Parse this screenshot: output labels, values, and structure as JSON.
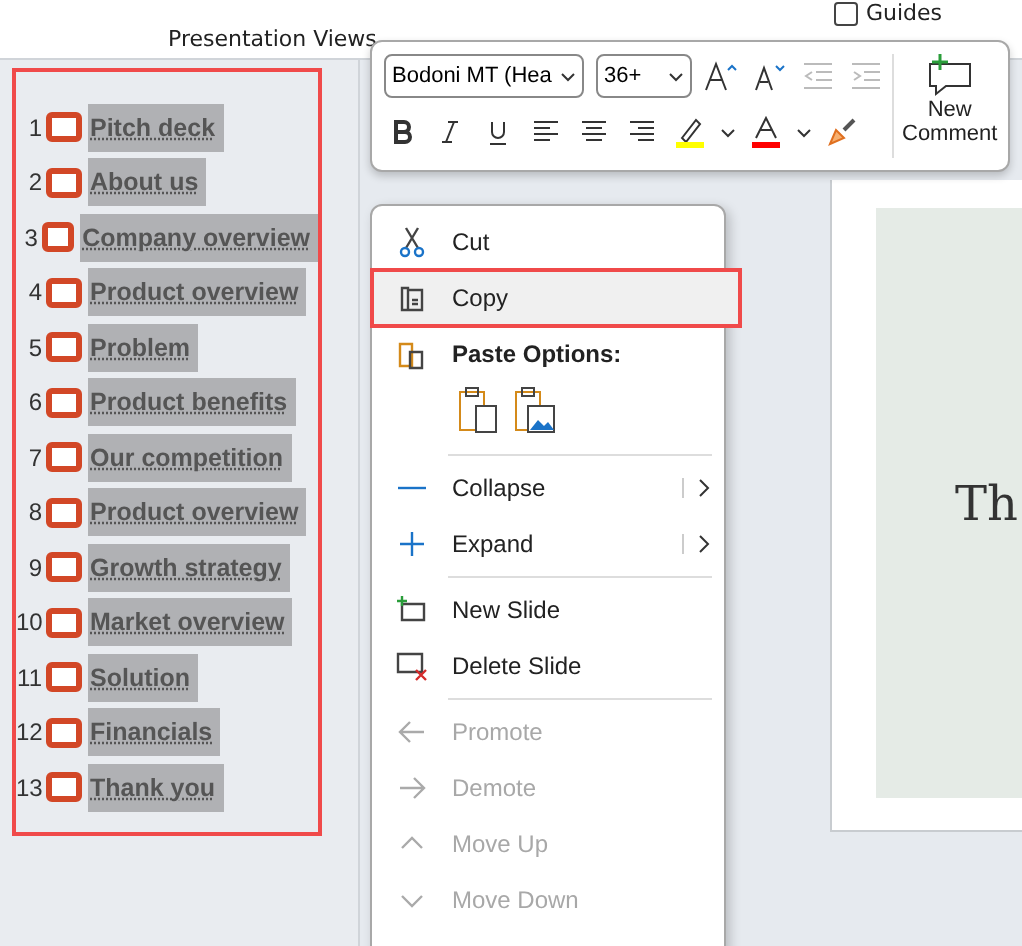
{
  "ribbon": {
    "group_label": "Presentation Views",
    "guides": {
      "label": "Guides",
      "checked": false
    }
  },
  "outline": {
    "items": [
      {
        "number": "1",
        "title": "Pitch deck"
      },
      {
        "number": "2",
        "title": "About us"
      },
      {
        "number": "3",
        "title": "Company overview"
      },
      {
        "number": "4",
        "title": "Product overview"
      },
      {
        "number": "5",
        "title": "Problem"
      },
      {
        "number": "6",
        "title": "Product benefits"
      },
      {
        "number": "7",
        "title": "Our competition"
      },
      {
        "number": "8",
        "title": "Product overview"
      },
      {
        "number": "9",
        "title": "Growth strategy"
      },
      {
        "number": "10",
        "title": "Market overview"
      },
      {
        "number": "11",
        "title": "Solution"
      },
      {
        "number": "12",
        "title": "Financials"
      },
      {
        "number": "13",
        "title": "Thank you"
      }
    ]
  },
  "mini_toolbar": {
    "font": "Bodoni MT (Hea",
    "size": "36+",
    "new_comment": "New Comment"
  },
  "context_menu": {
    "items": [
      {
        "kind": "item",
        "label": "Cut",
        "selected": false,
        "disabled": false
      },
      {
        "kind": "item",
        "label": "Copy",
        "selected": true,
        "disabled": false
      },
      {
        "kind": "header",
        "label": "Paste Options:"
      },
      {
        "kind": "paste"
      },
      {
        "kind": "divider"
      },
      {
        "kind": "submenu",
        "label": "Collapse",
        "selected": false,
        "disabled": false
      },
      {
        "kind": "submenu",
        "label": "Expand",
        "selected": false,
        "disabled": false
      },
      {
        "kind": "divider"
      },
      {
        "kind": "item",
        "label": "New Slide",
        "selected": false,
        "disabled": false
      },
      {
        "kind": "item",
        "label": "Delete Slide",
        "selected": false,
        "disabled": false
      },
      {
        "kind": "divider"
      },
      {
        "kind": "item",
        "label": "Promote",
        "selected": false,
        "disabled": true
      },
      {
        "kind": "item",
        "label": "Demote",
        "selected": false,
        "disabled": true
      },
      {
        "kind": "item",
        "label": "Move Up",
        "selected": false,
        "disabled": true
      },
      {
        "kind": "item",
        "label": "Move Down",
        "selected": false,
        "disabled": true
      }
    ]
  },
  "slide": {
    "title": "Th"
  }
}
